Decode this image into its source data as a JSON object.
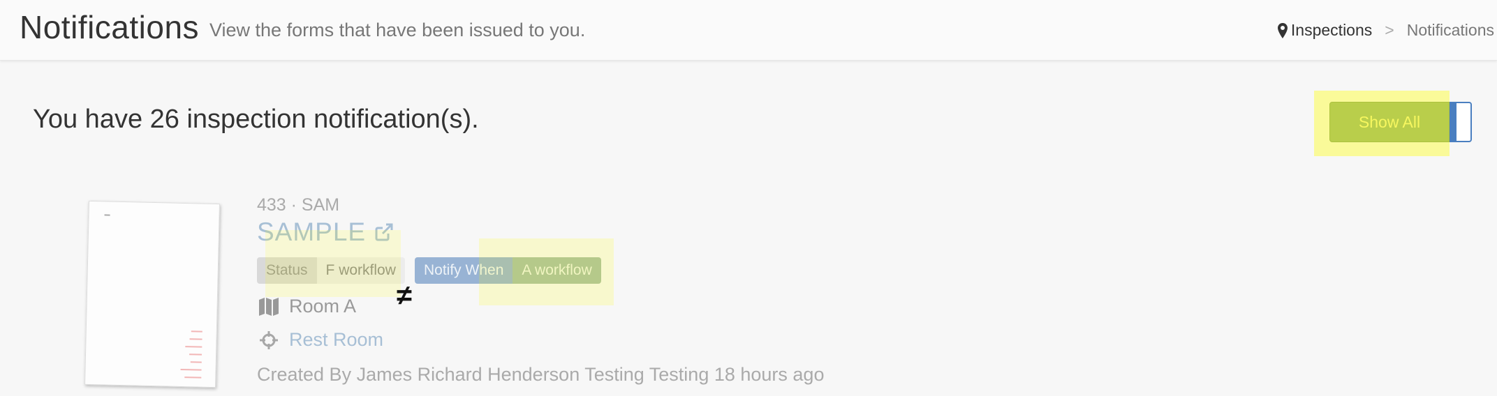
{
  "header": {
    "title": "Notifications",
    "subtitle": "View the forms that have been issued to you.",
    "breadcrumb": {
      "link_label": "Inspections",
      "separator": ">",
      "current": "Notifications"
    }
  },
  "main": {
    "count_text": "You have 26 inspection notification(s).",
    "show_all_label": "Show All"
  },
  "notification": {
    "code": "433 · SAM",
    "title": "SAMPLE",
    "status_label": "Status",
    "status_value": "F workflow",
    "notify_label": "Notify When",
    "notify_value": "A workflow",
    "comparison_symbol": "≠",
    "room": "Room A",
    "location": "Rest Room",
    "created_by": "Created By James Richard Henderson Testing Testing 18 hours ago"
  },
  "colors": {
    "title_link": "#a7bfd5",
    "show_all_bg": "#8fb07a",
    "show_all_text": "#f2f39a",
    "toggle_border": "#4a7fc0",
    "highlight": "#ffff00"
  },
  "icons": {
    "breadcrumb": "map-marker-icon",
    "external": "external-link-icon",
    "room": "map-icon",
    "location": "crosshairs-icon"
  }
}
